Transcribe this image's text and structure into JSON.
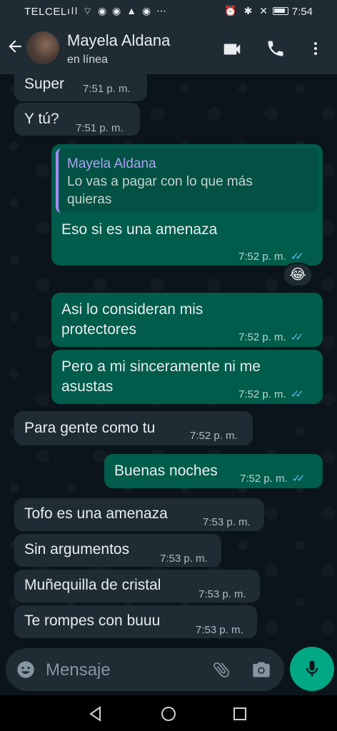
{
  "status_bar": {
    "carrier": "TELCEL",
    "left_icons": "ıll ⌔ ◉ ◉ ▲ ◉ ⋯",
    "right_icons": "⏰ ✱ ✕",
    "time": "7:54"
  },
  "header": {
    "contact_name": "Mayela Aldana",
    "contact_status": "en línea"
  },
  "messages": [
    {
      "direction": "in",
      "text": "Super",
      "time": "7:51 p. m."
    },
    {
      "direction": "in",
      "text": "Y tú?",
      "time": "7:51 p. m."
    },
    {
      "direction": "out",
      "quote_author": "Mayela Aldana",
      "quote_text": "Lo vas a pagar con lo que más quieras",
      "text": "Eso si es una amenaza",
      "time": "7:52 p. m.",
      "reaction": "😂"
    },
    {
      "direction": "out",
      "text": "Asi lo consideran mis protectores",
      "time": "7:52 p. m."
    },
    {
      "direction": "out",
      "text": "Pero a mi sinceramente ni me asustas",
      "time": "7:52 p. m."
    },
    {
      "direction": "in",
      "text": "Para gente como tu",
      "time": "7:52 p. m."
    },
    {
      "direction": "out",
      "text": "Buenas noches",
      "time": "7:52 p. m."
    },
    {
      "direction": "in",
      "text": "Tofo es una amenaza",
      "time": "7:53 p. m."
    },
    {
      "direction": "in",
      "text": "Sin argumentos",
      "time": "7:53 p. m."
    },
    {
      "direction": "in",
      "text": "Muñequilla de cristal",
      "time": "7:53 p. m."
    },
    {
      "direction": "in",
      "text": "Te rompes con buuu",
      "time": "7:53 p. m."
    }
  ],
  "composer": {
    "placeholder": "Mensaje"
  },
  "colors": {
    "background": "#0b141a",
    "incoming_bubble": "#1f2c34",
    "outgoing_bubble": "#005c4b",
    "accent": "#00a884",
    "read_ticks": "#53bdeb"
  },
  "icons": [
    "back-arrow-icon",
    "video-call-icon",
    "phone-icon",
    "more-vert-icon",
    "emoji-icon",
    "attach-icon",
    "camera-icon",
    "mic-icon",
    "nav-back-icon",
    "nav-home-icon",
    "nav-recents-icon"
  ]
}
